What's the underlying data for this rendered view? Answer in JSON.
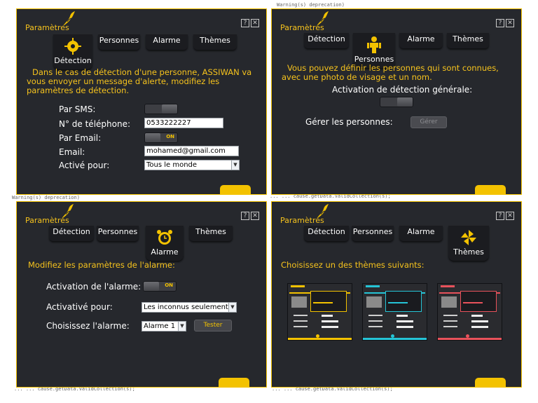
{
  "colors": {
    "accent": "#f3c200",
    "panel_bg": "#26282d",
    "theme_yellow": "#f3c200",
    "theme_cyan": "#25c4d6",
    "theme_red": "#e8525b"
  },
  "scraps": [
    "Warning(s) deprecation)",
    "Warning(s) deprecation)",
    "... ... cause.getData.ValidCollection(s);",
    "... ... cause.getData.ValidCollection(s);",
    "... ... cause.getData.ValidCollection(s);"
  ],
  "common": {
    "title": "Paramètres",
    "help_button": "?",
    "close_button": "✕"
  },
  "tabs": {
    "detection": "Détection",
    "persons": "Personnes",
    "alarm": "Alarme",
    "themes": "Thèmes"
  },
  "detection_panel": {
    "message": "Dans le cas de détection d'une personne, ASSIWAN va vous envoyer un message d'alerte, modifiez les paramètres de détection.",
    "sms_label": "Par SMS:",
    "phone_label": "N° de téléphone:",
    "phone_value": "0533222227",
    "email_toggle_label": "Par Email:",
    "email_toggle_state": "ON",
    "email_label": "Email:",
    "email_value": "mohamed@gmail.com",
    "active_for_label": "Activé pour:",
    "active_for_value": "Tous le monde"
  },
  "persons_panel": {
    "message": "Vous pouvez définir les personnes qui sont connues, avec une photo de visage et un nom.",
    "general_detection_label": "Activation de détection générale:",
    "manage_label": "Gérer les personnes:",
    "manage_button": "Gérer"
  },
  "alarm_panel": {
    "message": "Modifiez les paramètres de l'alarme:",
    "activation_label": "Activation de l'alarme:",
    "activation_state": "ON",
    "activated_for_label": "Activativé pour:",
    "activated_for_value": "Les inconnus seulement",
    "choose_label": "Choisissez l'alarme:",
    "choose_value": "Alarme 1",
    "test_button": "Tester"
  },
  "themes_panel": {
    "message": "Choisissez un des thèmes suivants:",
    "themes": [
      {
        "name": "yellow",
        "color": "#f3c200"
      },
      {
        "name": "cyan",
        "color": "#25c4d6"
      },
      {
        "name": "red",
        "color": "#e8525b"
      }
    ]
  }
}
